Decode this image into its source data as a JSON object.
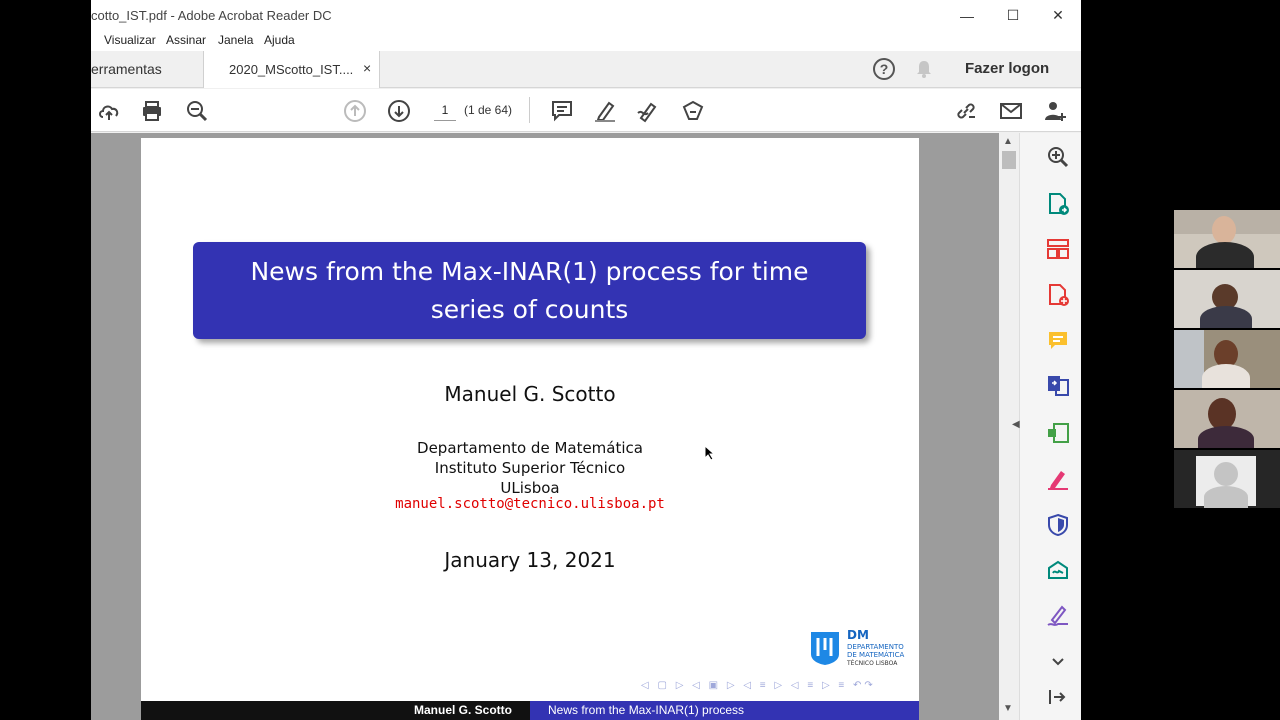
{
  "window": {
    "title": "cotto_IST.pdf - Adobe Acrobat Reader DC",
    "controls": {
      "minimize": "—",
      "maximize": "☐",
      "close": "✕"
    }
  },
  "menu": [
    "Visualizar",
    "Assinar",
    "Janela",
    "Ajuda"
  ],
  "tabs": {
    "tools": "erramentas",
    "document": "2020_MScotto_IST....",
    "close": "×"
  },
  "header": {
    "help": "?",
    "login": "Fazer logon"
  },
  "toolbar": {
    "icons": [
      "cloud-upload-icon",
      "print-icon",
      "zoom-out-icon",
      "page-up-icon",
      "page-down-icon",
      "comment-icon",
      "highlight-icon",
      "draw-icon",
      "stamp-icon",
      "share-link-icon",
      "email-icon",
      "add-user-icon"
    ],
    "page_number": "1",
    "page_of": "(1 de 64)"
  },
  "right_panel": {
    "icons": [
      "zoom-in-icon",
      "export-pdf-icon",
      "organize-pages-icon",
      "create-pdf-icon",
      "comment-icon",
      "combine-files-icon",
      "edit-pdf-icon",
      "fill-sign-icon",
      "protect-icon",
      "send-signature-icon",
      "sign-icon",
      "expand-icon",
      "collapse-panel-icon"
    ]
  },
  "slide": {
    "title": "News from the Max-INAR(1) process for time series of counts",
    "author": "Manuel G. Scotto",
    "affiliation": [
      "Departamento de Matemática",
      "Instituto Superior Técnico",
      "ULisboa"
    ],
    "email": "manuel.scotto@tecnico.ulisboa.pt",
    "date": "January 13, 2021",
    "logo": {
      "abbr": "DM",
      "line1": "DEPARTAMENTO",
      "line2": "DE MATEMÁTICA",
      "line3": "TÉCNICO LISBOA"
    },
    "nav_symbols": "◁ ▢ ▷ ◁ ▣ ▷ ◁ ≡ ▷ ◁ ≡ ▷ ≡ ↶↷",
    "footer_left": "Manuel G. Scotto",
    "footer_right": "News from the Max-INAR(1) process"
  },
  "participants": [
    "participant-1",
    "participant-2",
    "participant-3",
    "participant-4",
    "participant-5"
  ],
  "colors": {
    "slide_blue": "#3333b3",
    "email_red": "#e00000",
    "acrobat_red": "#d32f2f"
  }
}
